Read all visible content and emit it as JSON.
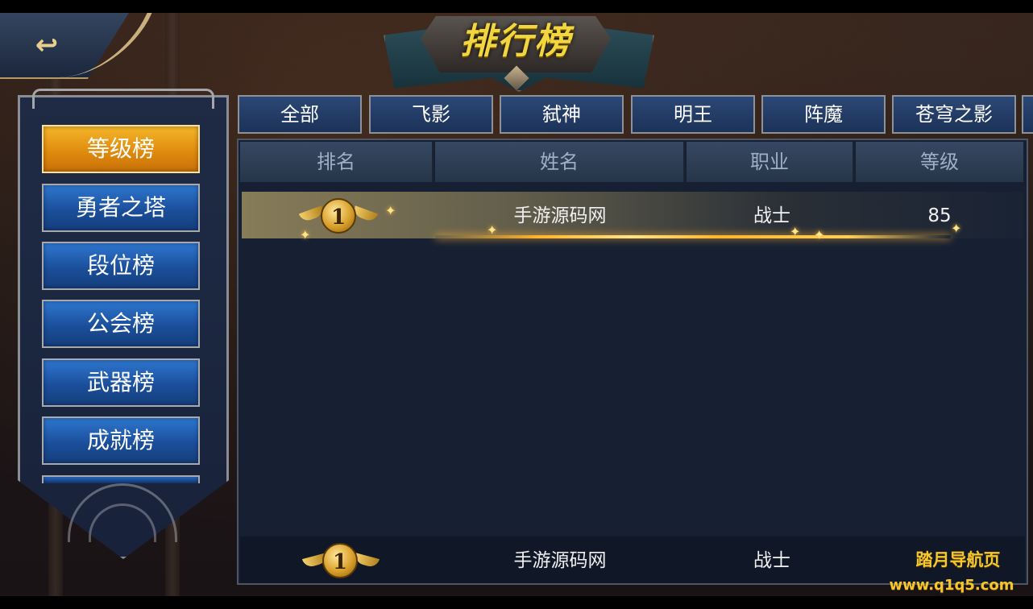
{
  "title": "排行榜",
  "back_icon": "back-arrow-icon",
  "sidebar": {
    "items": [
      {
        "label": "等级榜",
        "active": true
      },
      {
        "label": "勇者之塔",
        "active": false
      },
      {
        "label": "段位榜",
        "active": false
      },
      {
        "label": "公会榜",
        "active": false
      },
      {
        "label": "武器榜",
        "active": false
      },
      {
        "label": "成就榜",
        "active": false
      }
    ]
  },
  "tabs": [
    {
      "label": "全部"
    },
    {
      "label": "飞影"
    },
    {
      "label": "弑神"
    },
    {
      "label": "明王"
    },
    {
      "label": "阵魔"
    },
    {
      "label": "苍穹之影"
    }
  ],
  "table": {
    "headers": [
      "排名",
      "姓名",
      "职业",
      "等级"
    ],
    "rows": [
      {
        "rank": "1",
        "name": "手游源码网",
        "class": "战士",
        "level": "85"
      }
    ]
  },
  "my_rank": {
    "rank": "1",
    "name": "手游源码网",
    "class": "战士"
  },
  "watermark": {
    "line1": "踏月导航页",
    "line2": "www.q1q5.com"
  },
  "colors": {
    "accent_gold": "#f5c62e",
    "active_orange": "#e08c0f",
    "tab_blue": "#1c3258"
  }
}
